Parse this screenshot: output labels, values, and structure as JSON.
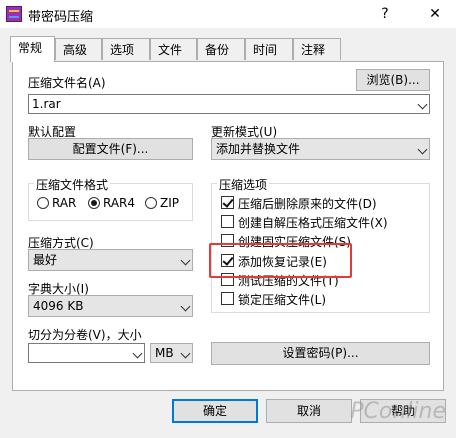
{
  "window": {
    "title": "带密码压缩",
    "help_symbol": "?",
    "close_symbol": "✕"
  },
  "tabs": [
    {
      "label": "常规",
      "active": true
    },
    {
      "label": "高级"
    },
    {
      "label": "选项"
    },
    {
      "label": "文件"
    },
    {
      "label": "备份"
    },
    {
      "label": "时间"
    },
    {
      "label": "注释"
    }
  ],
  "archive": {
    "name_label": "压缩文件名(A)",
    "browse_label": "浏览(B)...",
    "name_value": "1.rar"
  },
  "profile": {
    "label": "默认配置",
    "button_label": "配置文件(F)..."
  },
  "update_mode": {
    "label": "更新模式(U)",
    "value": "添加并替换文件"
  },
  "format": {
    "legend": "压缩文件格式",
    "options": [
      {
        "label": "RAR",
        "selected": false
      },
      {
        "label": "RAR4",
        "selected": true
      },
      {
        "label": "ZIP",
        "selected": false
      }
    ]
  },
  "method": {
    "label": "压缩方式(C)",
    "value": "最好"
  },
  "dict": {
    "label": "字典大小(I)",
    "value": "4096 KB"
  },
  "split": {
    "label": "切分为分卷(V)，大小",
    "value": "",
    "unit": "MB"
  },
  "options": {
    "legend": "压缩选项",
    "items": [
      {
        "label": "压缩后删除原来的文件(D)",
        "checked": true
      },
      {
        "label": "创建自解压格式压缩文件(X)",
        "checked": false
      },
      {
        "label": "创建固实压缩文件(S)",
        "checked": false
      },
      {
        "label": "添加恢复记录(E)",
        "checked": true
      },
      {
        "label": "测试压缩的文件(T)",
        "checked": false
      },
      {
        "label": "锁定压缩文件(L)",
        "checked": false
      }
    ]
  },
  "password_button": "设置密码(P)...",
  "footer": {
    "ok": "确定",
    "cancel": "取消",
    "help": "帮助"
  },
  "watermark": "PConline",
  "colors": {
    "highlight": "#e23b3b",
    "focus": "#0078d7"
  }
}
